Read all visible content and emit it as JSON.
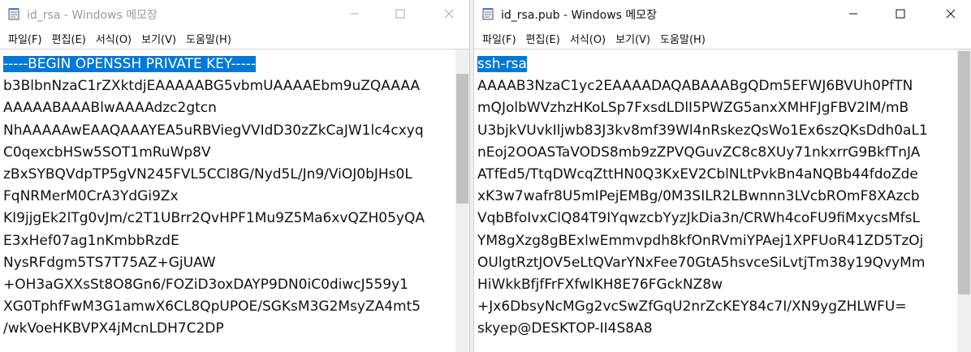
{
  "left": {
    "title": "id_rsa - Windows 메모장",
    "menu": [
      "파일(F)",
      "편집(E)",
      "서식(O)",
      "보기(V)",
      "도움말(H)"
    ],
    "lines": [
      "-----BEGIN OPENSSH PRIVATE KEY-----",
      "b3BlbnNzaC1rZXktdjEAAAAABG5vbmUAAAAEbm9uZQAAAA",
      "AAAAABAAABlwAAAAdzc2gtcn",
      "NhAAAAAwEAAQAAAYEA5uRBViegVVIdD30zZkCaJW1lc4cxyq",
      "C0qexcbHSw5SOT1mRuWp8V",
      "zBxSYBQVdpTP5gVN245FVL5CCl8G/Nyd5L/Jn9/ViOJ0bJHs0L",
      "FqNRMerM0CrA3YdGi9Zx",
      "KI9jjgEk2lTg0vJm/c2T1UBrr2QvHPF1Mu9Z5Ma6xvQZH05yQA",
      "E3xHef07ag1nKmbbRzdE",
      "NysRFdgm5TS7T75AZ+GjUAW",
      "+OH3aGXXsSt8O8Gn6/FOZiD3oxDAYP9DN0iC0diwcJ559y1",
      "XG0TphfFwM3G1amwX6CL8QpUPOE/SGKsM3G2MsyZA4mt5",
      "/wkVoeHKBVPX4jMcnLDH7C2DP"
    ]
  },
  "right": {
    "title": "id_rsa.pub - Windows 메모장",
    "menu": [
      "파일(F)",
      "편집(E)",
      "서식(O)",
      "보기(V)",
      "도움말(H)"
    ],
    "lines": [
      "ssh-rsa",
      "AAAAB3NzaC1yc2EAAAADAQABAAABgQDm5EFWJ6BVUh0PfTN",
      "mQJolbWVzhzHKoLSp7FxsdLDlI5PWZG5anxXMHFJgFBV2lM/mB",
      "U3bjkVUvkIljwb83J3kv8mf39Wl4nRskezQsWo1Ex6szQKsDdh0aL1",
      "nEoj2OOASTaVODS8mb9zZPVQGuvZC8c8XUy71nkxrrG9BkfTnJA",
      "ATfEd5/TtqDWcqZttHN0Q3KxEV2CblNLtPvkBn4aNQBb44fdoZde",
      "xK3w7wafr8U5mIPejEMBg/0M3SILR2LBwnnn3LVcbROmF8XAzcb",
      "VqbBfoIvxClQ84T9IYqwzcbYyzJkDia3n/CRWh4coFU9fiMxycsMfsL",
      "YM8gXzg8gBExlwEmmvpdh8kfOnRVmiYPAej1XPFUoR41ZD5TzOj",
      "OUlgtRztJOV5eLtQVarYNxFee70GtA5hsvceSiLvtjTm38y19QvyMm",
      "HiWkkBfjfFrFXfwlKH8E76FGckNZ8w",
      "+Jx6DbsyNcMGg2vcSwZfGqU2nrZcKEY84c7I/XN9ygZHLWFU=",
      "skyep@DESKTOP-II4S8A8"
    ]
  }
}
